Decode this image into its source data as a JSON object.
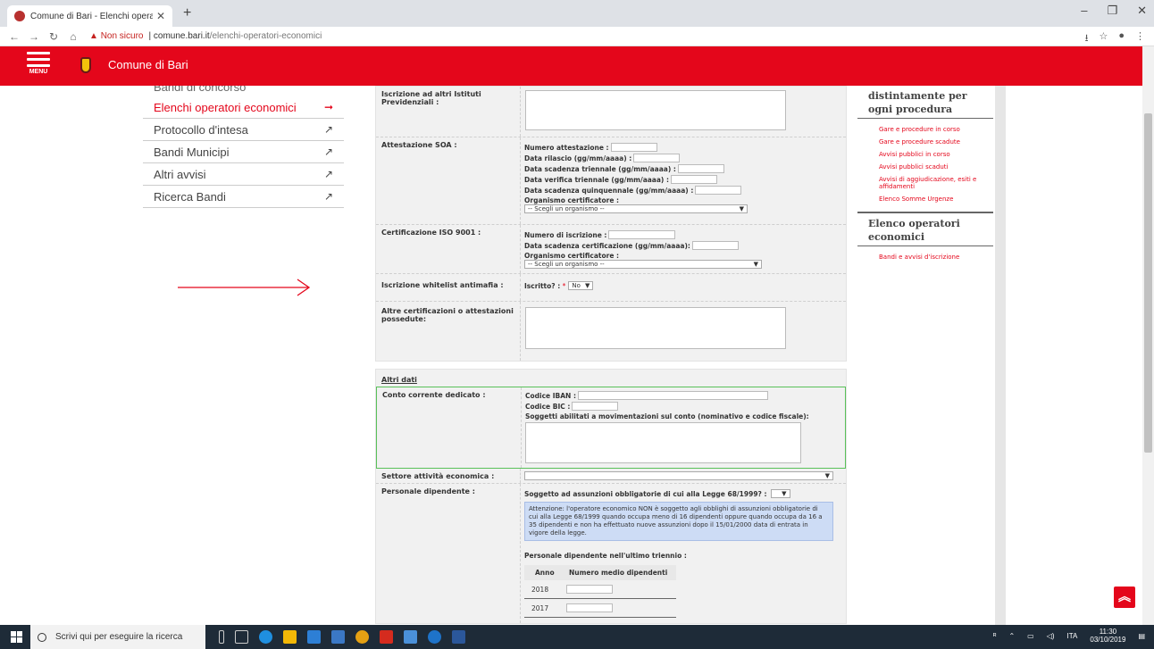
{
  "browser": {
    "tab_title": "Comune di Bari - Elenchi operato",
    "tab_close": "✕",
    "new_tab": "+",
    "security_label": "Non sicuro",
    "url_host": "comune.bari.it",
    "url_path": "/elenchi-operatori-economici"
  },
  "header": {
    "menu_label": "MENU",
    "site_name": "Comune di Bari"
  },
  "leftnav": {
    "cut_item": "Bandi di concorso",
    "items": [
      {
        "label": "Elenchi operatori economici",
        "arrow": "➞"
      },
      {
        "label": "Protocollo d'intesa",
        "arrow": "↗"
      },
      {
        "label": "Bandi Municipi",
        "arrow": "↗"
      },
      {
        "label": "Altri avvisi",
        "arrow": "↗"
      },
      {
        "label": "Ricerca Bandi",
        "arrow": "↗"
      }
    ]
  },
  "form": {
    "istituti_label": "Iscrizione ad altri Istituti Previdenziali :",
    "soa": {
      "label": "Attestazione SOA :",
      "numero": "Numero attestazione :",
      "rilascio": "Data rilascio (gg/mm/aaaa) :",
      "scadenza_triennale": "Data scadenza triennale (gg/mm/aaaa) :",
      "verifica_triennale": "Data verifica triennale (gg/mm/aaaa) :",
      "scadenza_quinquennale": "Data scadenza quinquennale (gg/mm/aaaa) :",
      "organismo": "Organismo certificatore :",
      "select": "-- Scegli un organismo --"
    },
    "iso": {
      "label": "Certificazione ISO 9001 :",
      "numero": "Numero di iscrizione :",
      "scadenza": "Data scadenza certificazione (gg/mm/aaaa):",
      "organismo": "Organismo certificatore :",
      "select": "-- Scegli un organismo --"
    },
    "whitelist": {
      "label": "Iscrizione whitelist antimafia :",
      "iscritto": "Iscritto? :",
      "req": "*",
      "value": "No"
    },
    "altre_label": "Altre certificazioni o attestazioni possedute:",
    "altri_dati_title": "Altri dati",
    "conto": {
      "label": "Conto corrente dedicato :",
      "iban": "Codice IBAN :",
      "bic": "Codice BIC :",
      "soggetti": "Soggetti abilitati a movimentazioni sul conto (nominativo e codice fiscale):"
    },
    "settore_label": "Settore attività economica :",
    "personale": {
      "label": "Personale dipendente :",
      "question": "Soggetto ad assunzioni obbligatorie di cui alla Legge 68/1999? :",
      "note": "Attenzione: l'operatore economico NON è soggetto agli obblighi di assunzioni obbligatorie di cui alla Legge 68/1999 quando occupa meno di 16 dipendenti oppure quando occupa da 16 a 35 dipendenti e non ha effettuato nuove assunzioni dopo il 15/01/2000 data di entrata in vigore della legge.",
      "triennio": "Personale dipendente nell'ultimo triennio :",
      "col_anno": "Anno",
      "col_numero": "Numero medio dipendenti",
      "years": [
        "2018",
        "2017"
      ]
    }
  },
  "right": {
    "title1": "distintamente per ogni procedura",
    "links1": [
      "Gare e procedure in corso",
      "Gare e procedure scadute",
      "Avvisi pubblici in corso",
      "Avvisi pubblici scaduti",
      "Avvisi di aggiudicazione, esiti e affidamenti",
      "Elenco Somme Urgenze"
    ],
    "title2": "Elenco operatori economici",
    "links2": [
      "Bandi e avvisi d'iscrizione"
    ]
  },
  "taskbar": {
    "search_placeholder": "Scrivi qui per eseguire la ricerca",
    "lang": "ITA",
    "time": "11:30",
    "date": "03/10/2019"
  },
  "colors": {
    "brand_red": "#e4061b",
    "note_blue": "#cddcf5",
    "taskbar": "#1e2b38"
  }
}
